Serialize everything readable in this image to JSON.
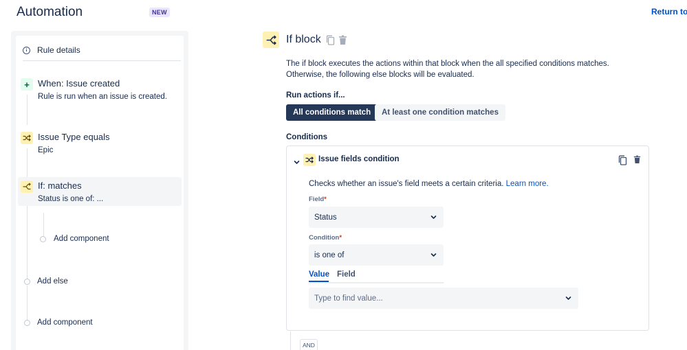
{
  "header": {
    "title": "Automation",
    "badge": "NEW",
    "return_link": "Return to"
  },
  "sidebar": {
    "rule_details": "Rule details",
    "components": [
      {
        "icon": "plus-icon",
        "title": "When: Issue created",
        "subtitle": "Rule is run when an issue is created."
      },
      {
        "icon": "shuffle-icon",
        "title": "Issue Type equals",
        "subtitle": "Epic"
      },
      {
        "icon": "branch-icon",
        "title": "If: matches",
        "subtitle": "Status is one of: ...",
        "selected": true
      }
    ],
    "nested_add_component": "Add component",
    "add_else": "Add else",
    "add_component": "Add component"
  },
  "editor": {
    "title": "If block",
    "description": "The if block executes the actions within that block when the all specified conditions matches. Otherwise, the following else blocks will be evaluated.",
    "run_actions_label": "Run actions if...",
    "options": [
      "All conditions match",
      "At least one condition matches"
    ],
    "selected_option": "All conditions match",
    "conditions_label": "Conditions",
    "condition_card": {
      "title": "Issue fields condition",
      "description": "Checks whether an issue's field meets a certain criteria.",
      "learn_more": "Learn more.",
      "field_label": "Field",
      "field_value": "Status",
      "condition_label": "Condition",
      "condition_value": "is one of",
      "tabs": [
        "Value",
        "Field"
      ],
      "active_tab": "Value",
      "value_placeholder": "Type to find value..."
    },
    "and_label": "AND"
  },
  "colors": {
    "primary_dark": "#253858",
    "link": "#0052cc",
    "icon_yellow_bg": "#fff0b3",
    "icon_green_bg": "#e3fcef",
    "required": "#de350b"
  }
}
